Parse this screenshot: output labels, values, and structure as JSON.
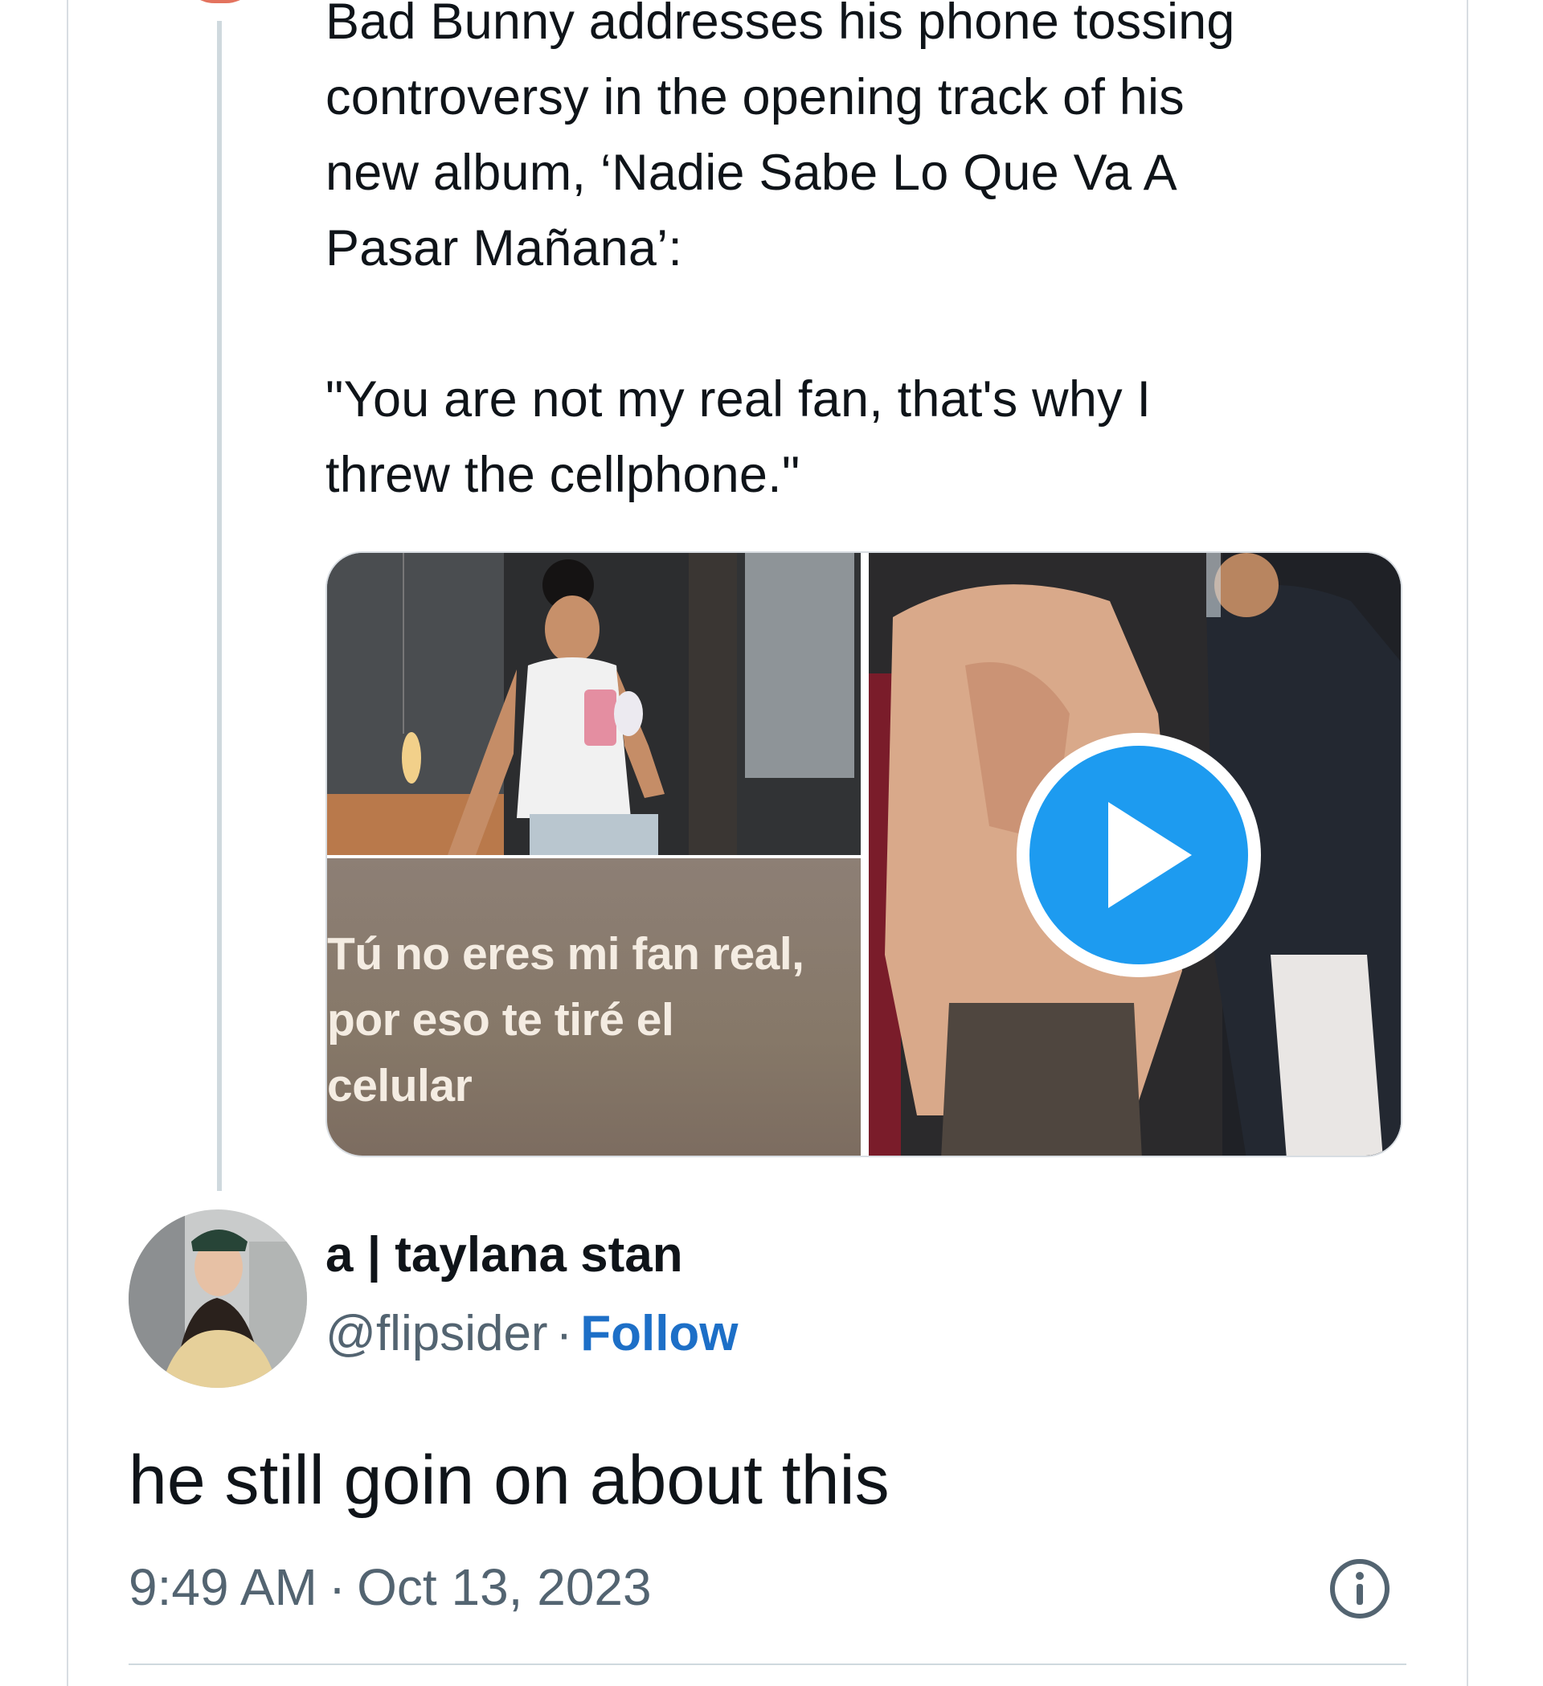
{
  "quoted_tweet": {
    "lines": [
      "Bad Bunny addresses his phone tossing",
      "controversy in the opening track of his",
      "new album, ‘Nadie Sabe Lo Que Va A",
      "Pasar Mañana’:"
    ],
    "quote_lines": [
      "\"You are not my real fan, that's why I",
      "threw the cellphone.\""
    ],
    "media": {
      "left_caption_lines": [
        "Tú no eres mi fan real,",
        "por eso te tiré el",
        "celular"
      ],
      "play_icon": "play-icon"
    }
  },
  "reply": {
    "author_name": "a | taylana stan",
    "handle": "@flipsider",
    "separator": "·",
    "follow_label": "Follow",
    "text": "he still goin on about this",
    "time": "9:49 AM",
    "date": "Oct 13, 2023",
    "info_icon": "info-icon"
  },
  "colors": {
    "link_blue": "#1d6fc7",
    "play_blue": "#1d9bf0",
    "secondary_text": "#536471"
  }
}
